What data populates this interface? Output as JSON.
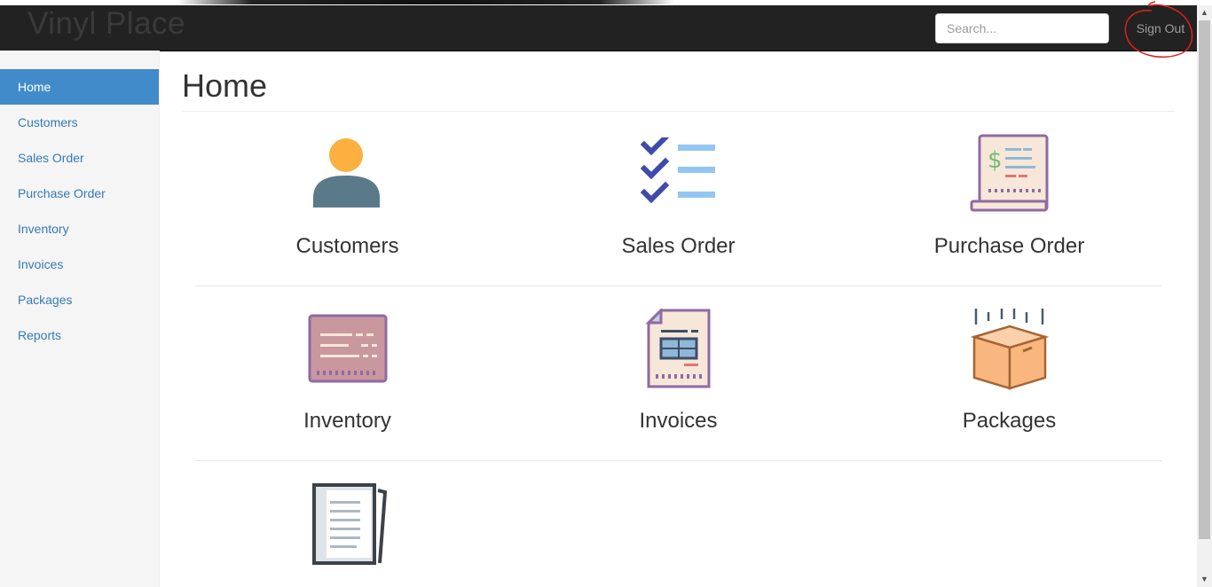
{
  "navbar": {
    "brand": "Vinyl Place",
    "search_placeholder": "Search...",
    "signout_label": "Sign Out",
    "annotation_color": "#e0201a"
  },
  "sidebar": {
    "items": [
      {
        "label": "Home",
        "active": true
      },
      {
        "label": "Customers"
      },
      {
        "label": "Sales Order"
      },
      {
        "label": "Purchase Order"
      },
      {
        "label": "Inventory"
      },
      {
        "label": "Invoices"
      },
      {
        "label": "Packages"
      },
      {
        "label": "Reports"
      }
    ]
  },
  "main": {
    "title": "Home",
    "tiles": [
      {
        "label": "Customers",
        "icon": "customer-icon"
      },
      {
        "label": "Sales Order",
        "icon": "checklist-icon"
      },
      {
        "label": "Purchase Order",
        "icon": "receipt-icon"
      },
      {
        "label": "Inventory",
        "icon": "inventory-card-icon"
      },
      {
        "label": "Invoices",
        "icon": "invoice-icon"
      },
      {
        "label": "Packages",
        "icon": "box-icon"
      },
      {
        "label": "",
        "icon": "reports-icon"
      }
    ]
  },
  "colors": {
    "navbar_bg": "#222222",
    "sidebar_active": "#428bca",
    "link": "#337ab7"
  }
}
